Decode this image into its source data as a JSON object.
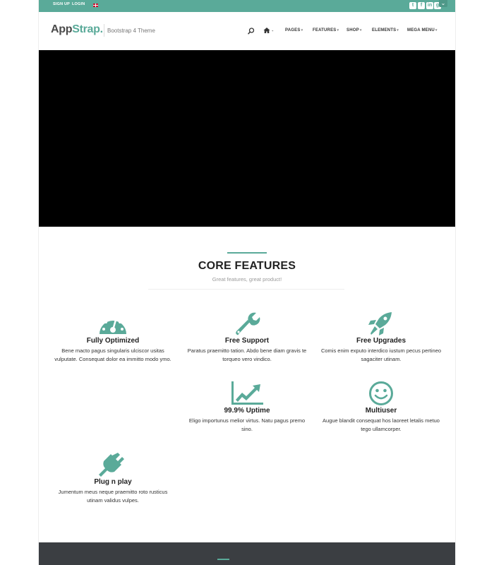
{
  "topbar": {
    "signup_label": "SIGN UP",
    "login_label": "LOGIN",
    "social_icons": [
      "twitter-icon",
      "facebook-icon",
      "linkedin-icon",
      "google-plus-icon"
    ]
  },
  "header": {
    "logo_part1": "App",
    "logo_part2": "Strap.",
    "tagline": "Bootstrap 4 Theme",
    "nav": [
      {
        "label": "PAGES"
      },
      {
        "label": "FEATURES"
      },
      {
        "label": "SHOP"
      },
      {
        "label": "ELEMENTS"
      },
      {
        "label": "MEGA MENU"
      }
    ]
  },
  "section": {
    "title": "CORE FEATURES",
    "subtitle": "Great features, great product!"
  },
  "features": [
    {
      "title": "Fully Optimized",
      "desc": "Bene macto pagus singularis ulciscor usitas vulputate. Consequat dolor ea immitto modo ymo.",
      "icon": "dashboard-icon"
    },
    {
      "title": "Free Support",
      "desc": "Paratus praemitto tation. Abdo bene diam gravis te torqueo vero vindico.",
      "icon": "wrench-icon"
    },
    {
      "title": "Free Upgrades",
      "desc": "Comis enim exputo interdico iustum pecus pertineo sagaciter utinam.",
      "icon": "rocket-icon"
    },
    {
      "title": "99.9% Uptime",
      "desc": "Eligo importunus melior virtus. Natu pagus premo sino.",
      "icon": "line-chart-icon"
    },
    {
      "title": "Multiuser",
      "desc": "Augue blandit consequat hos laoreet letalis metuo tego ullamcorper.",
      "icon": "smile-icon"
    },
    {
      "title": "Plug n play",
      "desc": "Jumentum meus neque praemitto roto rusticus utinam validus vulpes.",
      "icon": "plug-icon"
    }
  ],
  "colors": {
    "accent": "#5aaa99",
    "hero": "#000000",
    "footer": "#3b3e42"
  }
}
